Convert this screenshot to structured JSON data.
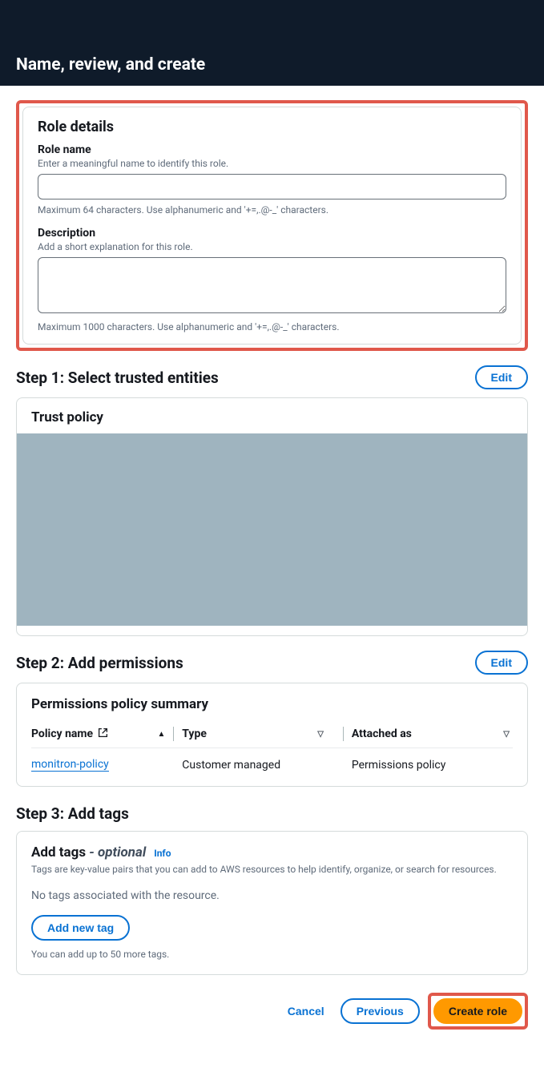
{
  "header": {
    "title": "Name, review, and create"
  },
  "role_details": {
    "section_title": "Role details",
    "name_label": "Role name",
    "name_sub": "Enter a meaningful name to identify this role.",
    "name_value": "",
    "name_hint": "Maximum 64 characters. Use alphanumeric and '+=,.@-_' characters.",
    "desc_label": "Description",
    "desc_sub": "Add a short explanation for this role.",
    "desc_value": "",
    "desc_hint": "Maximum 1000 characters. Use alphanumeric and '+=,.@-_' characters."
  },
  "step1": {
    "title": "Step 1: Select trusted entities",
    "edit": "Edit",
    "trust_title": "Trust policy"
  },
  "step2": {
    "title": "Step 2: Add permissions",
    "edit": "Edit",
    "summary_title": "Permissions policy summary",
    "cols": {
      "policy": "Policy name",
      "type": "Type",
      "attached": "Attached as"
    },
    "row": {
      "policy": "monitron-policy",
      "type": "Customer managed",
      "attached": "Permissions policy"
    }
  },
  "step3": {
    "title": "Step 3: Add tags",
    "tags_title": "Add tags",
    "optional": " - optional",
    "info": "Info",
    "desc": "Tags are key-value pairs that you can add to AWS resources to help identify, organize, or search for resources.",
    "empty": "No tags associated with the resource.",
    "add_btn": "Add new tag",
    "hint": "You can add up to 50 more tags."
  },
  "footer": {
    "cancel": "Cancel",
    "previous": "Previous",
    "create": "Create role"
  }
}
